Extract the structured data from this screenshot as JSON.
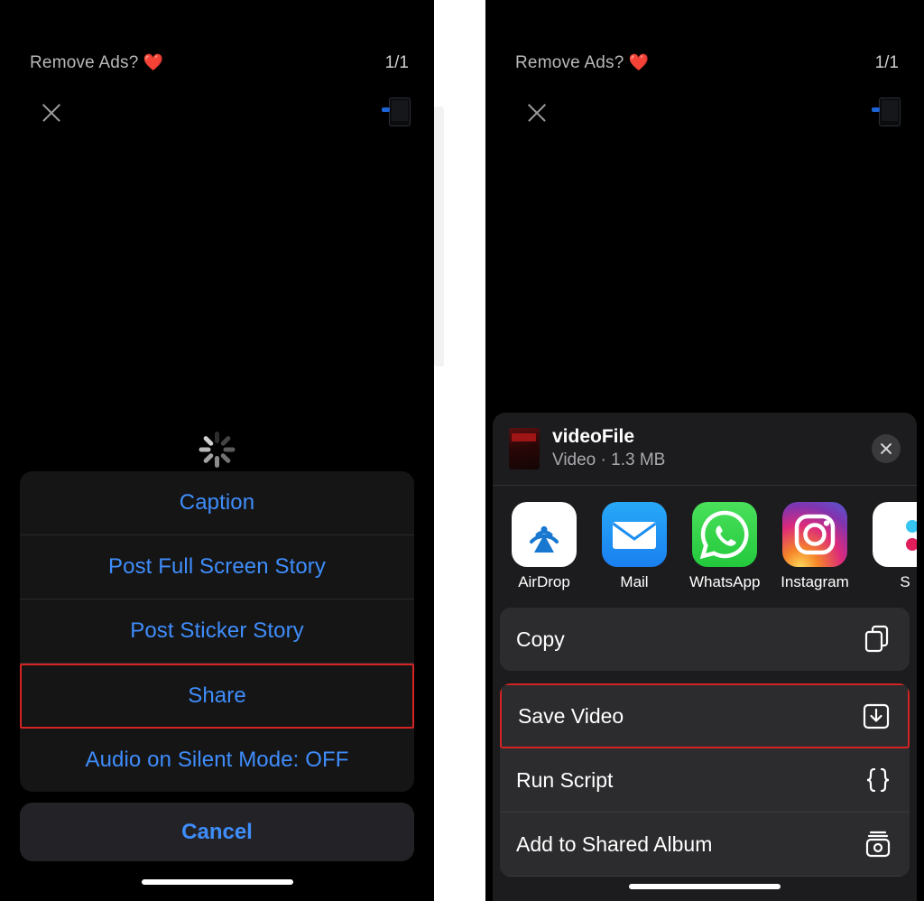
{
  "banner": {
    "ad_label": "Remove Ads?",
    "ad_heart": "❤️",
    "page_count": "1/1",
    "close_icon": "close-x-icon",
    "device_icon": "phone-device-icon"
  },
  "left_panel": {
    "loading_icon": "activity-spinner-icon",
    "action_sheet": [
      {
        "label": "Caption",
        "highlighted": false
      },
      {
        "label": "Post Full Screen Story",
        "highlighted": false
      },
      {
        "label": "Post Sticker Story",
        "highlighted": false
      },
      {
        "label": "Share",
        "highlighted": true
      },
      {
        "label": "Audio on Silent Mode: OFF",
        "highlighted": false
      }
    ],
    "cancel_label": "Cancel"
  },
  "right_panel": {
    "share_sheet": {
      "file_name": "videoFile",
      "file_meta": "Video · 1.3 MB",
      "close_icon": "close-circle-icon",
      "thumbnail_icon": "video-thumbnail",
      "apps": [
        {
          "label": "AirDrop",
          "icon": "airdrop-icon"
        },
        {
          "label": "Mail",
          "icon": "mail-icon"
        },
        {
          "label": "WhatsApp",
          "icon": "whatsapp-icon"
        },
        {
          "label": "Instagram",
          "icon": "instagram-icon"
        },
        {
          "label": "S",
          "icon": "slack-icon"
        }
      ],
      "actions": [
        {
          "label": "Copy",
          "icon": "copy-icon",
          "highlighted": false
        },
        {
          "label": "Save Video",
          "icon": "save-download-icon",
          "highlighted": true
        },
        {
          "label": "Run Script",
          "icon": "braces-icon",
          "highlighted": false
        },
        {
          "label": "Add to Shared Album",
          "icon": "shared-album-icon",
          "highlighted": false
        }
      ]
    }
  },
  "colors": {
    "accent_blue": "#3f8dfb",
    "highlight_red": "#d42424",
    "sheet_bg": "#1c1c1e",
    "action_row_bg": "#2c2c2e"
  }
}
